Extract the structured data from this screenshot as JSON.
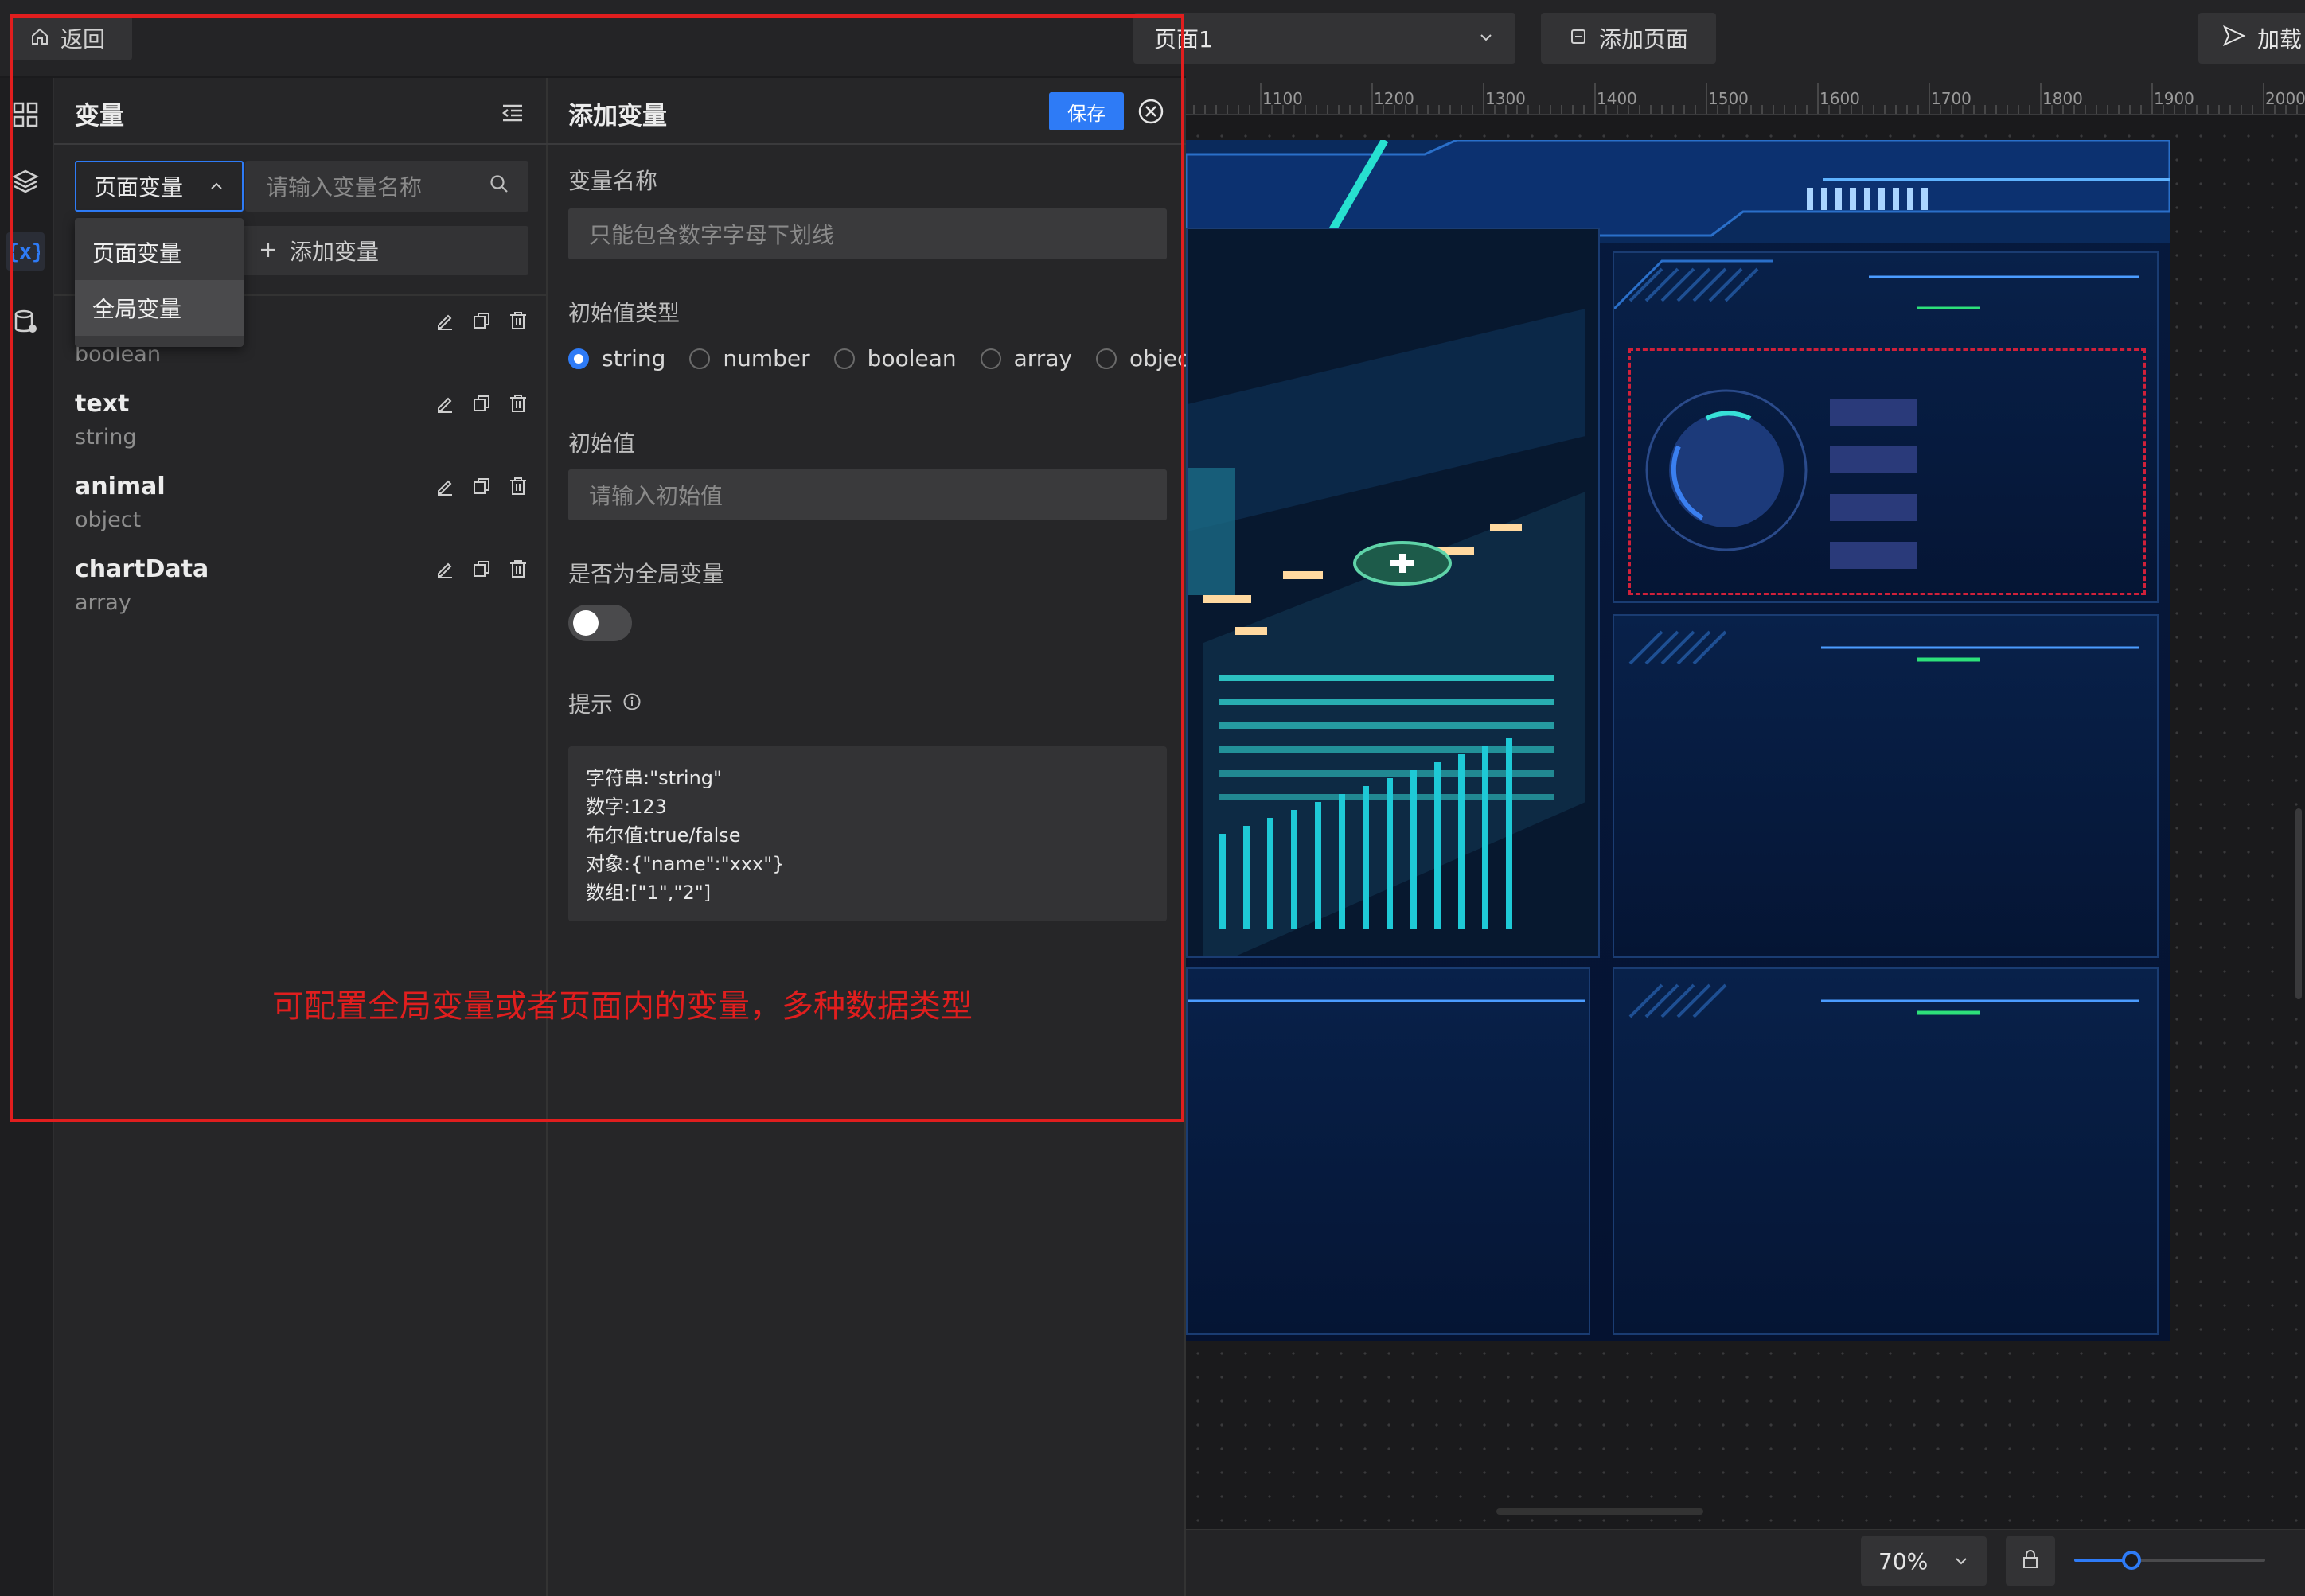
{
  "topbar": {
    "back_label": "返回",
    "page_select_value": "页面1",
    "add_page_label": "添加页面",
    "publish_label": "加载"
  },
  "variables_panel": {
    "title": "变量",
    "scope_select_value": "页面变量",
    "scope_options": [
      "页面变量",
      "全局变量"
    ],
    "search_placeholder": "请输入变量名称",
    "add_variable_label": "添加变量",
    "items": [
      {
        "name": "",
        "type": "boolean"
      },
      {
        "name": "text",
        "type": "string"
      },
      {
        "name": "animal",
        "type": "object"
      },
      {
        "name": "chartData",
        "type": "array"
      }
    ]
  },
  "add_variable_panel": {
    "title": "添加变量",
    "save_label": "保存",
    "name_label": "变量名称",
    "name_placeholder": "只能包含数字字母下划线",
    "init_type_label": "初始值类型",
    "types": [
      "string",
      "number",
      "boolean",
      "array",
      "object"
    ],
    "selected_type": "string",
    "init_value_label": "初始值",
    "init_value_placeholder": "请输入初始值",
    "global_label": "是否为全局变量",
    "global_enabled": false,
    "hint_label": "提示",
    "hint_lines": [
      "字符串:\"string\"",
      "数字:123",
      "布尔值:true/false",
      "对象:{\"name\":\"xxx\"}",
      "数组:[\"1\",\"2\"]"
    ]
  },
  "annotation": {
    "text": "可配置全局变量或者页面内的变量，多种数据类型",
    "color": "#e01e1e"
  },
  "ruler": {
    "ticks": [
      "1100",
      "1200",
      "1300",
      "1400",
      "1500",
      "1600",
      "1700",
      "1800",
      "1900",
      "2000"
    ]
  },
  "bottombar": {
    "zoom_value": "70%",
    "zoom_slider_fraction": 0.3
  },
  "colors": {
    "accent": "#2e7bf6",
    "background": "#1b1b1d",
    "panel": "#262628"
  }
}
